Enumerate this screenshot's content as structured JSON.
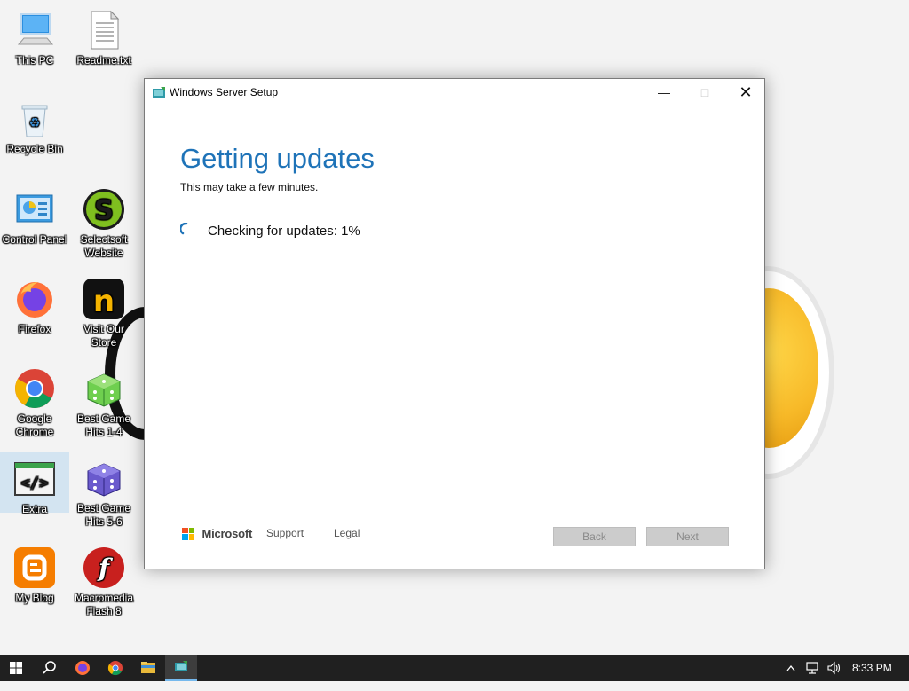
{
  "desktop": {
    "icons": [
      {
        "label": "This PC"
      },
      {
        "label": "Readme.txt"
      },
      {
        "label": "Recycle Bin"
      },
      {
        "label": "Control Panel"
      },
      {
        "label": "Selectsoft Website"
      },
      {
        "label": "Firefox"
      },
      {
        "label": "Visit Our Store"
      },
      {
        "label": "Google Chrome"
      },
      {
        "label": "Best Game Hits 1-4"
      },
      {
        "label": "Extra"
      },
      {
        "label": "Best Game Hits 5-6"
      },
      {
        "label": "My Blog"
      },
      {
        "label": "Macromedia Flash 8"
      }
    ]
  },
  "window": {
    "title": "Windows Server Setup",
    "minimize_glyph": "—",
    "maximize_glyph": "□",
    "close_glyph": "✕",
    "heading": "Getting updates",
    "subheading": "This may take a few minutes.",
    "status": "Checking for updates: 1%",
    "footer": {
      "brand": "Microsoft",
      "support_label": "Support",
      "legal_label": "Legal",
      "back_label": "Back",
      "next_label": "Next"
    },
    "accent_color": "#1e73b8"
  },
  "taskbar": {
    "clock": "8:33 PM",
    "pinned": [
      "start",
      "search",
      "firefox",
      "chrome",
      "file-explorer",
      "windows-server-setup"
    ],
    "active_app": "Windows Server Setup"
  }
}
